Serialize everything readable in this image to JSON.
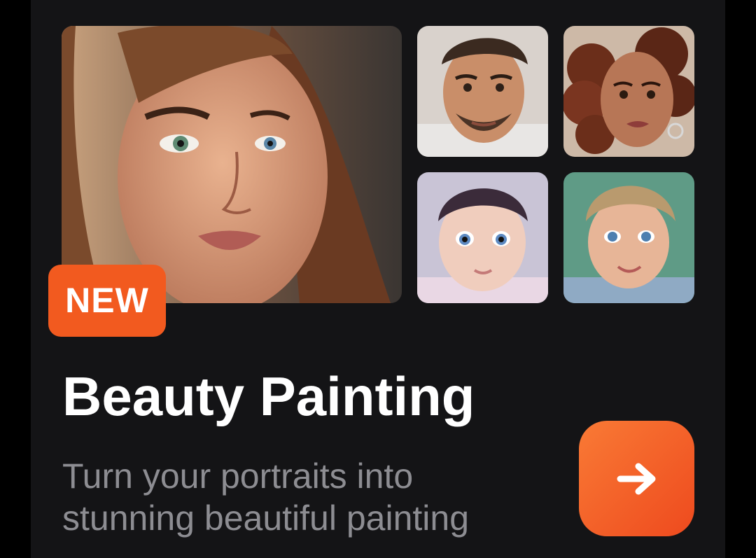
{
  "card": {
    "badge": "NEW",
    "title": "Beauty Painting",
    "subtitle_line1": "Turn your portraits into",
    "subtitle_line2": "stunning beautiful painting"
  },
  "photos": [
    {
      "subject": "woman-portrait"
    },
    {
      "subject": "man-portrait"
    },
    {
      "subject": "curly-hair-woman-portrait"
    },
    {
      "subject": "baby-portrait"
    },
    {
      "subject": "child-portrait"
    }
  ],
  "action_button": {
    "icon": "arrow-right-icon"
  },
  "colors": {
    "background": "#000000",
    "card": "#141416",
    "accent": "#F25A1F",
    "title": "#FFFFFF",
    "subtitle": "#8D8D92"
  }
}
